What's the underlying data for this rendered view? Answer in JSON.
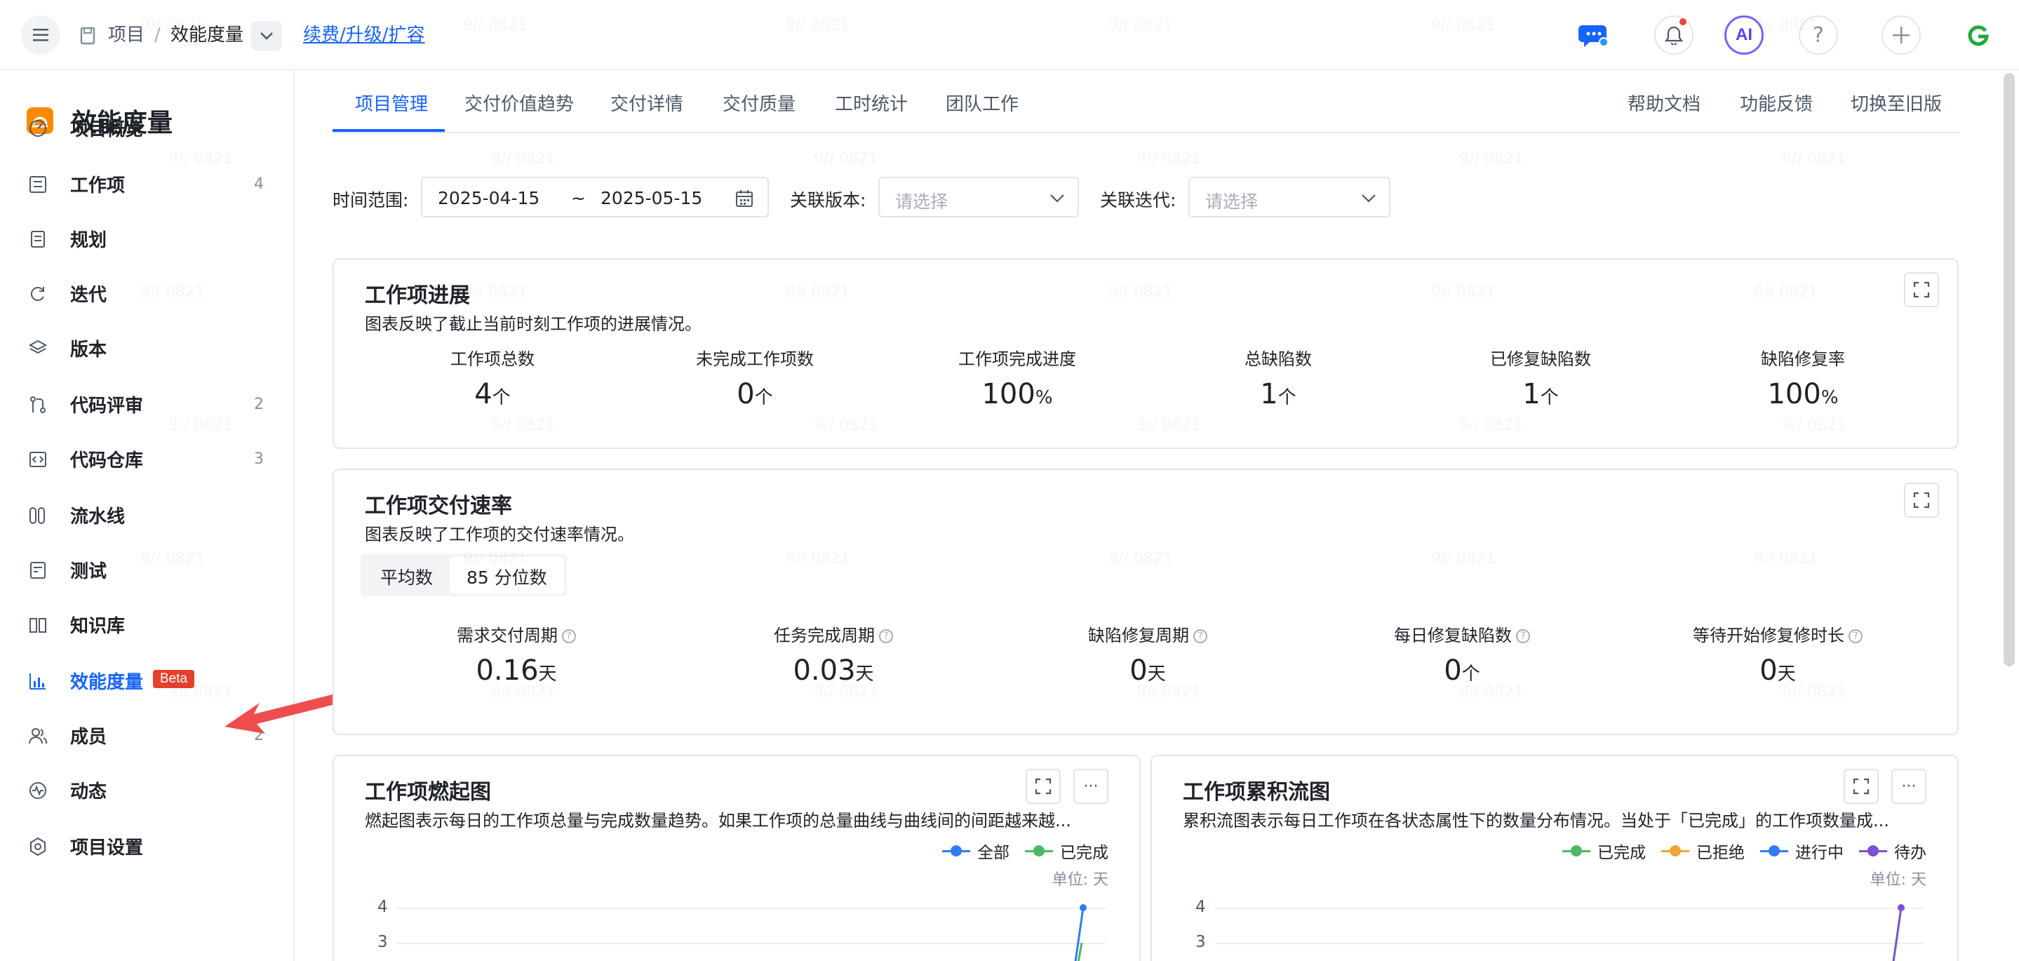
{
  "topbar": {
    "crumb_project": "项目",
    "crumb_sep": "/",
    "crumb_current": "效能度量",
    "renew_link": "续费/升级/扩容",
    "ai_label": "AI",
    "help_label": "?",
    "icons": [
      "menu-icon",
      "chat-icon",
      "bell-icon",
      "ai-icon",
      "help-icon",
      "plus-icon",
      "brand-g-icon"
    ],
    "colors": {
      "accent": "#1664ff",
      "notify": "#f53f3f",
      "ai": "#5b3df5",
      "brand_g": "#1faa3a"
    }
  },
  "sidebar": {
    "title": "效能度量",
    "items": [
      {
        "label": "项目概览",
        "count": "",
        "icon": "dashboard-icon"
      },
      {
        "label": "工作项",
        "count": "4",
        "icon": "workitem-icon"
      },
      {
        "label": "规划",
        "count": "",
        "icon": "plan-icon"
      },
      {
        "label": "迭代",
        "count": "",
        "icon": "iteration-icon"
      },
      {
        "label": "版本",
        "count": "",
        "icon": "version-icon"
      },
      {
        "label": "代码评审",
        "count": "2",
        "icon": "code-review-icon"
      },
      {
        "label": "代码仓库",
        "count": "3",
        "icon": "code-repo-icon"
      },
      {
        "label": "流水线",
        "count": "",
        "icon": "pipeline-icon"
      },
      {
        "label": "测试",
        "count": "",
        "icon": "test-icon"
      },
      {
        "label": "知识库",
        "count": "",
        "icon": "book-icon"
      },
      {
        "label": "效能度量",
        "count": "",
        "icon": "bar-chart-icon",
        "badge": "Beta",
        "active": true
      },
      {
        "label": "成员",
        "count": "2",
        "icon": "members-icon"
      },
      {
        "label": "动态",
        "count": "",
        "icon": "activity-icon"
      },
      {
        "label": "项目设置",
        "count": "",
        "icon": "settings-icon"
      }
    ]
  },
  "tabs": {
    "items": [
      "项目管理",
      "交付价值趋势",
      "交付详情",
      "交付质量",
      "工时统计",
      "团队工作"
    ],
    "active": "项目管理",
    "right": [
      "帮助文档",
      "功能反馈",
      "切换至旧版"
    ]
  },
  "filters": {
    "time_label": "时间范围:",
    "start_date": "2025-04-15",
    "range_sep": "~",
    "end_date": "2025-05-15",
    "version_label": "关联版本:",
    "version_placeholder": "请选择",
    "iteration_label": "关联迭代:",
    "iteration_placeholder": "请选择"
  },
  "progress_card": {
    "title": "工作项进展",
    "desc": "图表反映了截止当前时刻工作项的进展情况。",
    "stats": [
      {
        "label": "工作项总数",
        "value": "4",
        "unit": "个"
      },
      {
        "label": "未完成工作项数",
        "value": "0",
        "unit": "个"
      },
      {
        "label": "工作项完成进度",
        "value": "100",
        "unit": "%"
      },
      {
        "label": "总缺陷数",
        "value": "1",
        "unit": "个"
      },
      {
        "label": "已修复缺陷数",
        "value": "1",
        "unit": "个"
      },
      {
        "label": "缺陷修复率",
        "value": "100",
        "unit": "%"
      }
    ]
  },
  "rate_card": {
    "title": "工作项交付速率",
    "desc": "图表反映了工作项的交付速率情况。",
    "seg_options": [
      "平均数",
      "85 分位数"
    ],
    "seg_active": "85 分位数",
    "stats": [
      {
        "label": "需求交付周期",
        "value": "0.16",
        "unit": "天"
      },
      {
        "label": "任务完成周期",
        "value": "0.03",
        "unit": "天"
      },
      {
        "label": "缺陷修复周期",
        "value": "0",
        "unit": "天"
      },
      {
        "label": "每日修复缺陷数",
        "value": "0",
        "unit": "个"
      },
      {
        "label": "等待开始修复修时长",
        "value": "0",
        "unit": "天"
      }
    ]
  },
  "burnup_card": {
    "title": "工作项燃起图",
    "desc": "燃起图表示每日的工作项总量与完成数量趋势。如果工作项的总量曲线与曲线间的间距越来越...",
    "more": "···",
    "unit_text": "单位: 天",
    "legend": [
      {
        "name": "全部",
        "color": "#2f7cf6"
      },
      {
        "name": "已完成",
        "color": "#4cb963"
      }
    ],
    "y_ticks": [
      "4",
      "3"
    ]
  },
  "cfd_card": {
    "title": "工作项累积流图",
    "desc": "累积流图表示每日工作项在各状态属性下的数量分布情况。当处于「已完成」的工作项数量成...",
    "more": "···",
    "unit_text": "单位: 天",
    "legend": [
      {
        "name": "已完成",
        "color": "#4cb963"
      },
      {
        "name": "已拒绝",
        "color": "#f0a43a"
      },
      {
        "name": "进行中",
        "color": "#2f7cf6"
      },
      {
        "name": "待办",
        "color": "#7b4fd6"
      }
    ],
    "y_ticks": [
      "4",
      "3"
    ]
  },
  "watermark_text": "9// 0821"
}
